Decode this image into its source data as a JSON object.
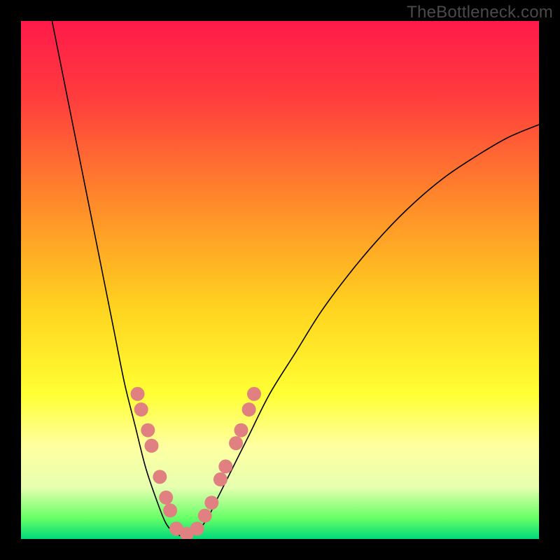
{
  "watermark": "TheBottleneck.com",
  "chart_data": {
    "type": "line",
    "title": "",
    "xlabel": "",
    "ylabel": "",
    "xlim": [
      0,
      100
    ],
    "ylim": [
      0,
      100
    ],
    "background_gradient": {
      "stops": [
        {
          "offset": 0.0,
          "color": "#ff1a4a"
        },
        {
          "offset": 0.15,
          "color": "#ff3d3d"
        },
        {
          "offset": 0.35,
          "color": "#ff8a2a"
        },
        {
          "offset": 0.55,
          "color": "#ffd21f"
        },
        {
          "offset": 0.72,
          "color": "#ffff33"
        },
        {
          "offset": 0.82,
          "color": "#ffffa0"
        },
        {
          "offset": 0.9,
          "color": "#e6ffb0"
        },
        {
          "offset": 0.96,
          "color": "#66ff66"
        },
        {
          "offset": 1.0,
          "color": "#00d97a"
        }
      ]
    },
    "series": [
      {
        "name": "bottleneck-curve",
        "stroke": "#000000",
        "stroke_width": 1.6,
        "points": [
          {
            "x": 6,
            "y": 100
          },
          {
            "x": 8,
            "y": 90
          },
          {
            "x": 10,
            "y": 80
          },
          {
            "x": 12,
            "y": 70
          },
          {
            "x": 14,
            "y": 60
          },
          {
            "x": 16,
            "y": 50
          },
          {
            "x": 18,
            "y": 40
          },
          {
            "x": 20,
            "y": 30
          },
          {
            "x": 22,
            "y": 22
          },
          {
            "x": 24,
            "y": 14
          },
          {
            "x": 26,
            "y": 8
          },
          {
            "x": 28,
            "y": 3
          },
          {
            "x": 30,
            "y": 1
          },
          {
            "x": 32,
            "y": 0.5
          },
          {
            "x": 34,
            "y": 1.5
          },
          {
            "x": 36,
            "y": 4
          },
          {
            "x": 38,
            "y": 8
          },
          {
            "x": 41,
            "y": 14
          },
          {
            "x": 44,
            "y": 20
          },
          {
            "x": 48,
            "y": 28
          },
          {
            "x": 53,
            "y": 36
          },
          {
            "x": 58,
            "y": 44
          },
          {
            "x": 64,
            "y": 52
          },
          {
            "x": 70,
            "y": 59
          },
          {
            "x": 76,
            "y": 65
          },
          {
            "x": 82,
            "y": 70
          },
          {
            "x": 88,
            "y": 74
          },
          {
            "x": 94,
            "y": 77.5
          },
          {
            "x": 100,
            "y": 80
          }
        ]
      }
    ],
    "markers": {
      "color": "#e08080",
      "radius": 10,
      "points": [
        {
          "x": 22.5,
          "y": 28
        },
        {
          "x": 23.2,
          "y": 25
        },
        {
          "x": 24.5,
          "y": 21
        },
        {
          "x": 25.2,
          "y": 18
        },
        {
          "x": 26.8,
          "y": 12
        },
        {
          "x": 28,
          "y": 8
        },
        {
          "x": 28.8,
          "y": 5.5
        },
        {
          "x": 30,
          "y": 2
        },
        {
          "x": 32,
          "y": 1
        },
        {
          "x": 34,
          "y": 2
        },
        {
          "x": 35.5,
          "y": 4.5
        },
        {
          "x": 36.8,
          "y": 7
        },
        {
          "x": 38.5,
          "y": 11.5
        },
        {
          "x": 39.5,
          "y": 14
        },
        {
          "x": 41.5,
          "y": 18.5
        },
        {
          "x": 42.5,
          "y": 21
        },
        {
          "x": 44,
          "y": 25
        },
        {
          "x": 45,
          "y": 28
        }
      ]
    }
  }
}
